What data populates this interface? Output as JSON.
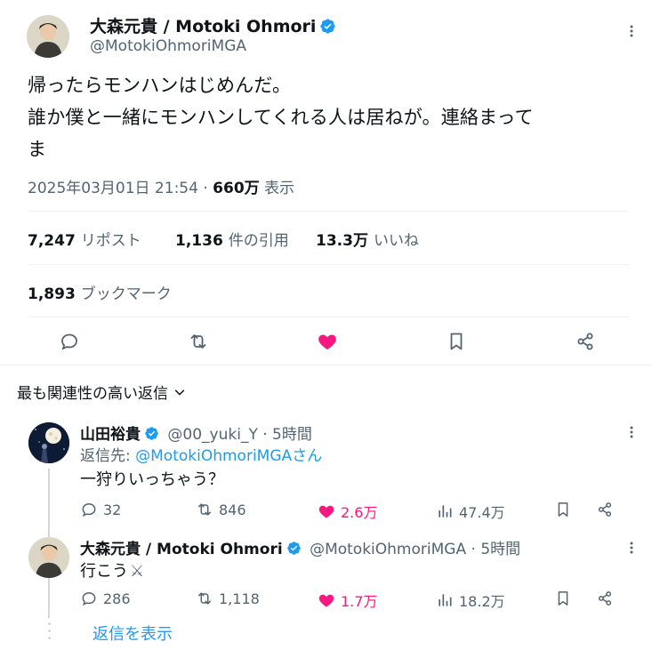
{
  "main_tweet": {
    "author_name": "大森元貴 / Motoki Ohmori",
    "author_handle": "@MotokiOhmoriMGA",
    "text_line1": "帰ったらモンハンはじめんだ。",
    "text_line2": "誰か僕と一緒にモンハンしてくれる人は居ねが。連絡まって",
    "text_line3": "ま",
    "timestamp": "2025年03月01日 21:54",
    "separator": "·",
    "views": "660万",
    "views_label": "表示",
    "stats": [
      {
        "value": "7,247",
        "label": "リポスト"
      },
      {
        "value": "1,136",
        "label": "件の引用"
      },
      {
        "value": "13.3万",
        "label": "いいね"
      }
    ],
    "bookmarks": {
      "value": "1,893",
      "label": "ブックマーク"
    },
    "actions": [
      "reply-icon",
      "retweet-icon",
      "heart-filled-icon",
      "bookmark-icon",
      "share-icon"
    ]
  },
  "sort": {
    "label": "最も関連性の高い返信"
  },
  "replies": [
    {
      "name": "山田裕貴",
      "handle": "@00_yuki_Y",
      "sep": "·",
      "time": "5時間",
      "reply_to_prefix": "返信先: ",
      "reply_to_target": "@MotokiOhmoriMGAさん",
      "text": "一狩りいっちゃう？",
      "replies": "32",
      "retweets": "846",
      "likes": "2.6万",
      "views": "47.4万"
    },
    {
      "name": "大森元貴 / Motoki Ohmori",
      "handle": "@MotokiOhmoriMGA",
      "sep": "·",
      "time": "5時間",
      "text": "行こう",
      "text_emoji": "⚔",
      "replies": "286",
      "retweets": "1,118",
      "likes": "1.7万",
      "views": "18.2万"
    }
  ],
  "show_replies": "返信を表示",
  "colors": {
    "accent": "#1d9bf0",
    "like": "#f91880",
    "secondary_text": "#536471",
    "divider": "#eff3f4"
  }
}
